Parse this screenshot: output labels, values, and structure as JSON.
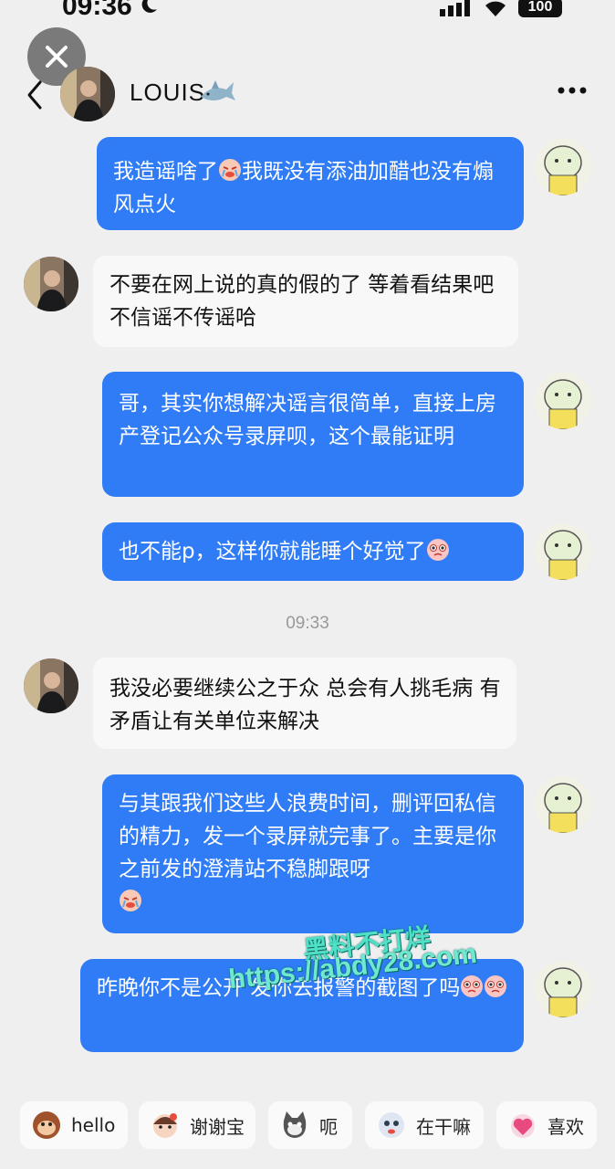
{
  "status": {
    "time": "09:36",
    "battery": "100"
  },
  "header": {
    "contact_name": "LOUIS"
  },
  "messages": [
    {
      "side": "out",
      "text": "我造谣啥了",
      "text2": "我既没有添油加醋也没有煽风点火"
    },
    {
      "side": "in",
      "text": "不要在网上说的真的假的了 等着看结果吧 不信谣不传谣哈"
    },
    {
      "side": "out",
      "text": "哥，其实你想解决谣言很简单，直接上房产登记公众号录屏呗，这个最能证明"
    },
    {
      "side": "out",
      "text": "也不能p，这样你就能睡个好觉了"
    },
    {
      "side": "in",
      "text": "我没必要继续公之于众 总会有人挑毛病 有矛盾让有关单位来解决"
    },
    {
      "side": "out",
      "text": "与其跟我们这些人浪费时间，删评回私信的精力，发一个录屏就完事了。主要是你之前发的澄清站不稳脚跟呀"
    },
    {
      "side": "out",
      "text": "昨晚你不是公开",
      "text2": "发你去报警的截图了吗"
    }
  ],
  "timestamp": "09:33",
  "watermark": {
    "line1": "黑料不打烊",
    "line2": "https://abdy28.com"
  },
  "quick_replies": [
    {
      "label": "hello",
      "icon": "monkey-icon"
    },
    {
      "label": "谢谢宝",
      "icon": "girl-icon"
    },
    {
      "label": "呃",
      "icon": "cat-icon"
    },
    {
      "label": "在干嘛",
      "icon": "peek-icon"
    },
    {
      "label": "喜欢",
      "icon": "love-icon"
    }
  ],
  "colors": {
    "outgoing_bubble": "#2f7cf6",
    "incoming_bubble": "#f8f8f8",
    "background": "#efefef"
  }
}
